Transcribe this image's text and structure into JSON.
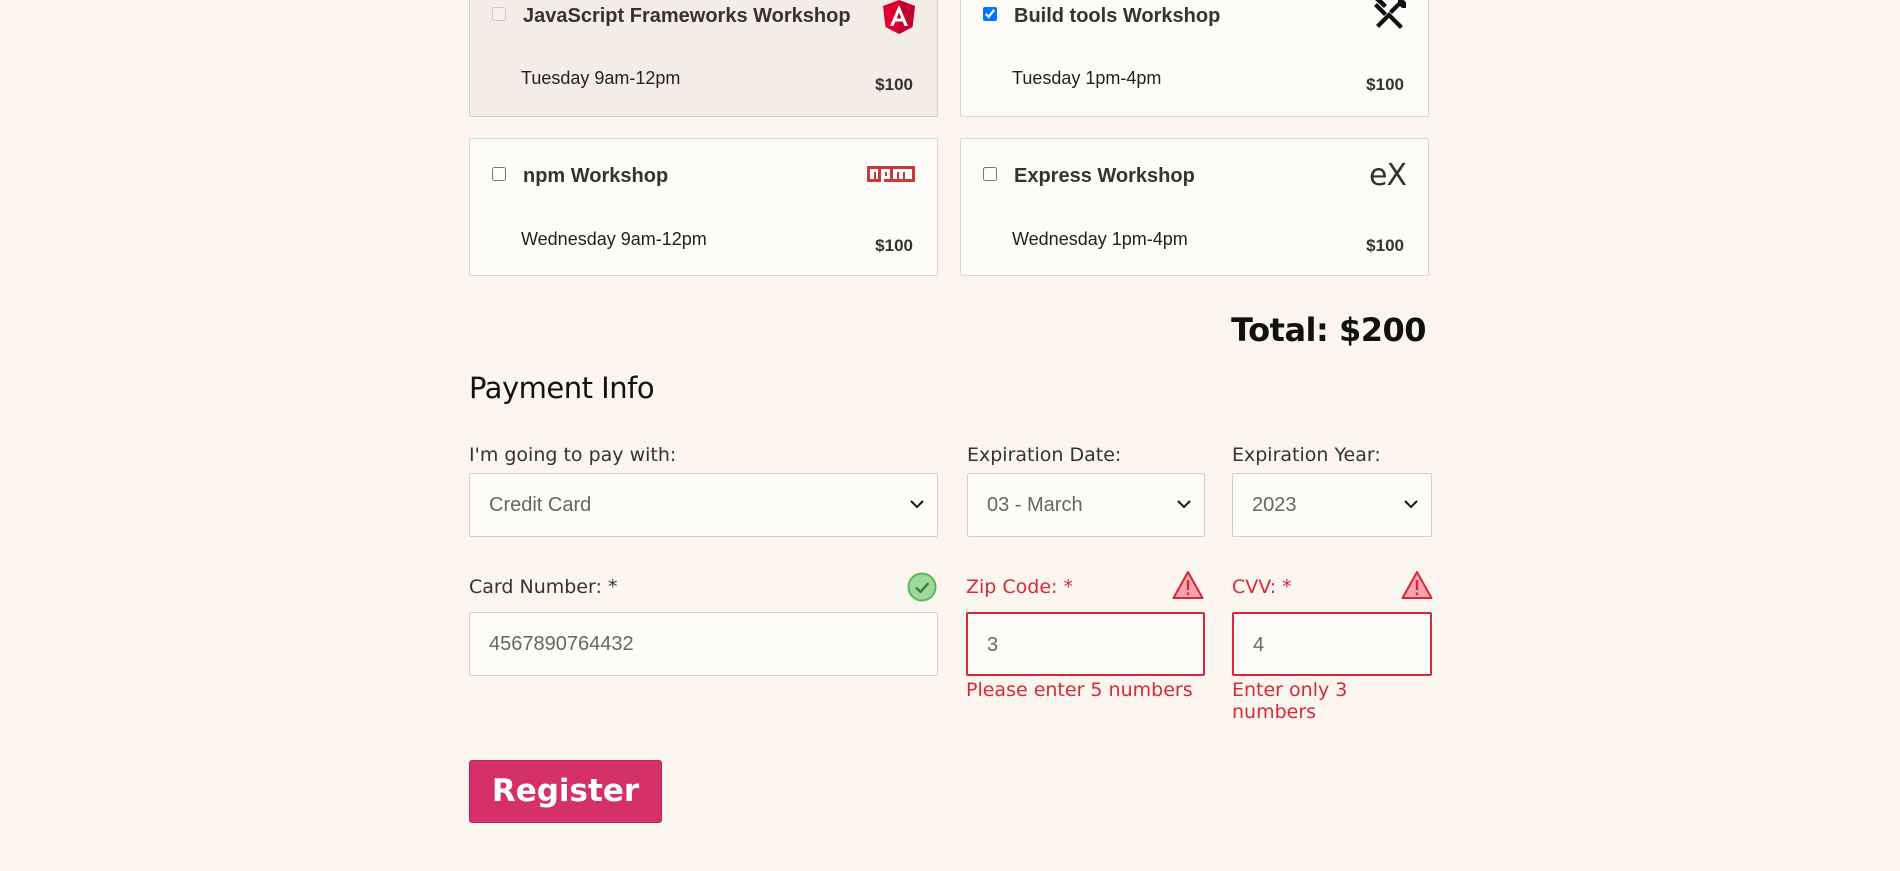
{
  "workshops": [
    {
      "title": "JavaScript Frameworks Workshop",
      "time": "Tuesday 9am-12pm",
      "price": "$100",
      "checked": false,
      "disabled": true,
      "icon": "angular-icon"
    },
    {
      "title": "Build tools Workshop",
      "time": "Tuesday 1pm-4pm",
      "price": "$100",
      "checked": true,
      "disabled": false,
      "icon": "build-tools-icon"
    },
    {
      "title": "npm Workshop",
      "time": "Wednesday 9am-12pm",
      "price": "$100",
      "checked": false,
      "disabled": false,
      "icon": "npm-icon"
    },
    {
      "title": "Express Workshop",
      "time": "Wednesday 1pm-4pm",
      "price": "$100",
      "checked": false,
      "disabled": false,
      "icon": "express-icon"
    }
  ],
  "total": "Total: $200",
  "payment": {
    "title": "Payment Info",
    "pay_with_label": "I'm going to pay with:",
    "pay_with_value": "Credit Card",
    "exp_date_label": "Expiration Date:",
    "exp_date_value": "03 - March",
    "exp_year_label": "Expiration Year:",
    "exp_year_value": "2023",
    "card_label": "Card Number:",
    "card_value": "4567890764432",
    "zip_label": "Zip Code:",
    "zip_value": "3",
    "zip_error": "Please enter 5 numbers",
    "cvv_label": "CVV:",
    "cvv_value": "4",
    "cvv_error": "Enter only 3 numbers",
    "required_mark": "*"
  },
  "register_label": "Register",
  "colors": {
    "background": "#faf5ee",
    "error": "#d8283c",
    "success": "#5cb85c",
    "brand_button": "#d6306a"
  }
}
